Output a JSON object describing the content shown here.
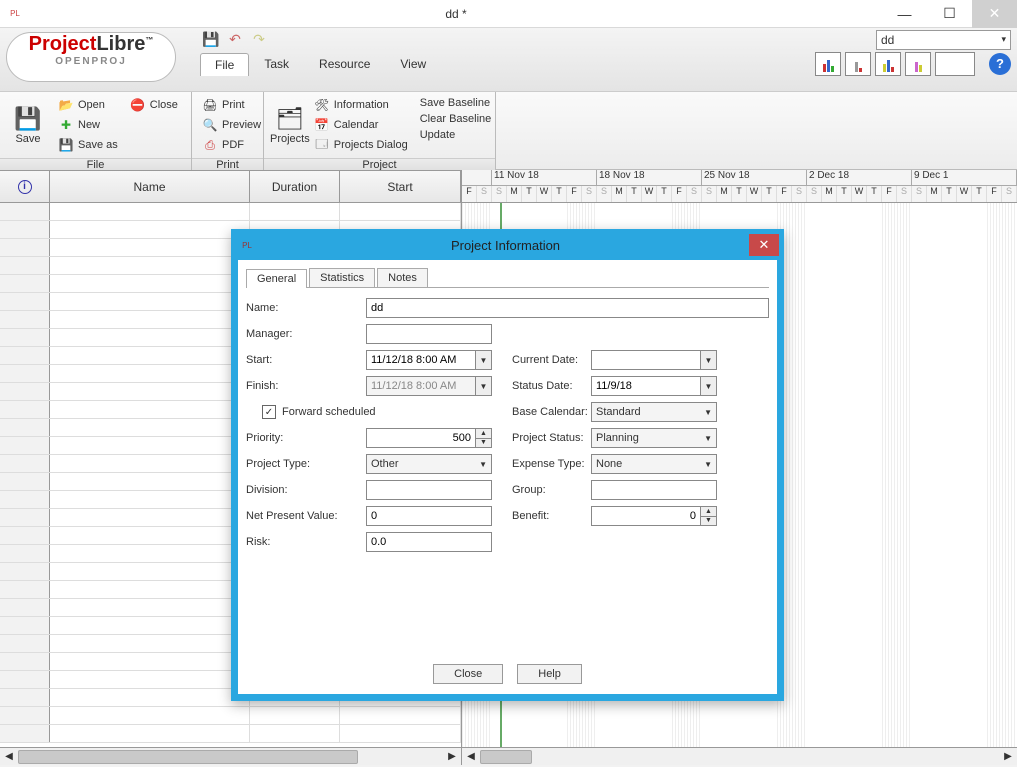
{
  "window": {
    "title": "dd *"
  },
  "sys_buttons": {
    "minimize": "—",
    "maximize": "☐",
    "close": "✕"
  },
  "logo": {
    "brand_a": "Project",
    "brand_b": "Libre",
    "tm": "™",
    "sub": "OPENPROJ"
  },
  "qat": {
    "save_icon": "💾",
    "undo_icon": "↶",
    "redo_icon": "↷"
  },
  "project_selector": "dd",
  "main_tabs": [
    "File",
    "Task",
    "Resource",
    "View"
  ],
  "help_icon": "?",
  "ribbon": {
    "file_group": {
      "label": "File",
      "save": "Save",
      "open": "Open",
      "new": "New",
      "saveas": "Save as",
      "close": "Close"
    },
    "print_group": {
      "label": "Print",
      "print": "Print",
      "preview": "Preview",
      "pdf": "PDF"
    },
    "project_group": {
      "label": "Project",
      "projects": "Projects",
      "information": "Information",
      "calendar": "Calendar",
      "projects_dialog": "Projects Dialog",
      "save_baseline": "Save Baseline",
      "clear_baseline": "Clear Baseline",
      "update": "Update"
    }
  },
  "table": {
    "columns": [
      "",
      "Name",
      "Duration",
      "Start"
    ]
  },
  "gantt": {
    "dates": [
      "11 Nov 18",
      "18 Nov 18",
      "25 Nov 18",
      "2 Dec 18",
      "9 Dec 1"
    ],
    "pre_days": [
      "F",
      "S"
    ],
    "week_days": [
      "S",
      "M",
      "T",
      "W",
      "T",
      "F",
      "S"
    ]
  },
  "dialog": {
    "title": "Project Information",
    "tabs": [
      "General",
      "Statistics",
      "Notes"
    ],
    "labels": {
      "name": "Name:",
      "manager": "Manager:",
      "start": "Start:",
      "finish": "Finish:",
      "forward": "Forward scheduled",
      "priority": "Priority:",
      "ptype": "Project Type:",
      "division": "Division:",
      "npv": "Net Present Value:",
      "risk": "Risk:",
      "curdate": "Current Date:",
      "statusdate": "Status Date:",
      "basecal": "Base Calendar:",
      "pstatus": "Project Status:",
      "etype": "Expense Type:",
      "group": "Group:",
      "benefit": "Benefit:"
    },
    "values": {
      "name": "dd",
      "manager": "",
      "start": "11/12/18 8:00 AM",
      "finish": "11/12/18 8:00 AM",
      "forward_checked": "✓",
      "priority": "500",
      "ptype": "Other",
      "division": "",
      "npv": "0",
      "risk": "0.0",
      "curdate": "",
      "statusdate": "11/9/18",
      "basecal": "Standard",
      "pstatus": "Planning",
      "etype": "None",
      "group": "",
      "benefit": "0"
    },
    "buttons": {
      "close": "Close",
      "help": "Help"
    }
  }
}
